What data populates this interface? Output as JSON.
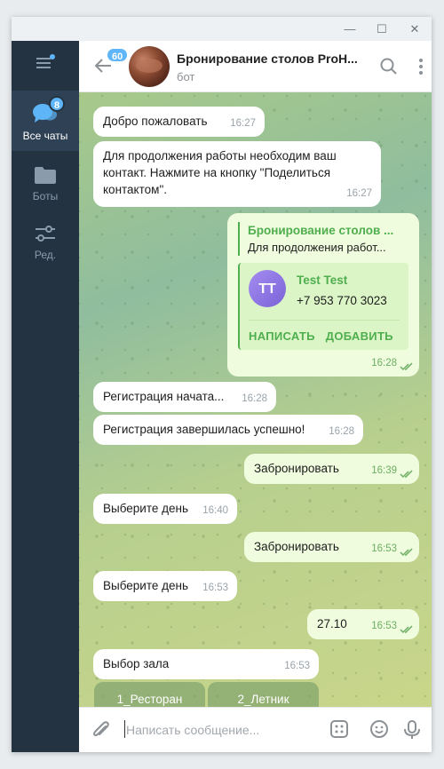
{
  "window_controls": {
    "minimize": "—",
    "maximize": "☐",
    "close": "✕"
  },
  "sidebar": {
    "menu_icon": "hamburger-icon",
    "items": [
      {
        "label": "Все чаты",
        "icon": "chats-icon",
        "badge": "8",
        "active": true
      },
      {
        "label": "Боты",
        "icon": "folder-icon"
      },
      {
        "label": "Ред.",
        "icon": "sliders-icon"
      }
    ]
  },
  "header": {
    "back_badge": "60",
    "title": "Бронирование столов ProH...",
    "subtitle": "бот",
    "search_icon": "search-icon",
    "more_icon": "more-vertical-icon"
  },
  "messages": [
    {
      "dir": "in",
      "text": "Добро пожаловать",
      "time": "16:27"
    },
    {
      "dir": "in",
      "text": "Для продолжения работы необходим ваш контакт. Нажмите на кнопку \"Поделиться контактом\".",
      "time": "16:27"
    },
    {
      "dir": "out",
      "reply_title": "Бронирование столов ...",
      "reply_text": "Для продолжения работ...",
      "contact": {
        "initials": "TT",
        "name": "Test Test",
        "phone": "+7 953 770 3023",
        "action_write": "НАПИСАТЬ",
        "action_add": "ДОБАВИТЬ"
      },
      "time": "16:28"
    },
    {
      "dir": "in",
      "text": "Регистрация начата...",
      "time": "16:28"
    },
    {
      "dir": "in",
      "text": "Регистрация завершилась успешно!",
      "time": "16:28"
    },
    {
      "dir": "out",
      "text": "Забронировать",
      "time": "16:39"
    },
    {
      "dir": "in",
      "text": "Выберите день",
      "time": "16:40"
    },
    {
      "dir": "out",
      "text": "Забронировать",
      "time": "16:53"
    },
    {
      "dir": "in",
      "text": "Выберите день",
      "time": "16:53"
    },
    {
      "dir": "out",
      "text": "27.10",
      "time": "16:53"
    },
    {
      "dir": "in",
      "text": "Выбор зала",
      "time": "16:53"
    }
  ],
  "keyboard": [
    "1_Ресторан",
    "2_Летник"
  ],
  "composer": {
    "placeholder": "Написать сообщение...",
    "attach_icon": "paperclip-icon",
    "commands_icon": "bot-commands-icon",
    "emoji_icon": "emoji-icon",
    "mic_icon": "microphone-icon"
  },
  "colors": {
    "accent": "#5eb5f7",
    "sidebar": "#243342",
    "out_bubble": "#effdde",
    "green": "#4fae4e"
  }
}
